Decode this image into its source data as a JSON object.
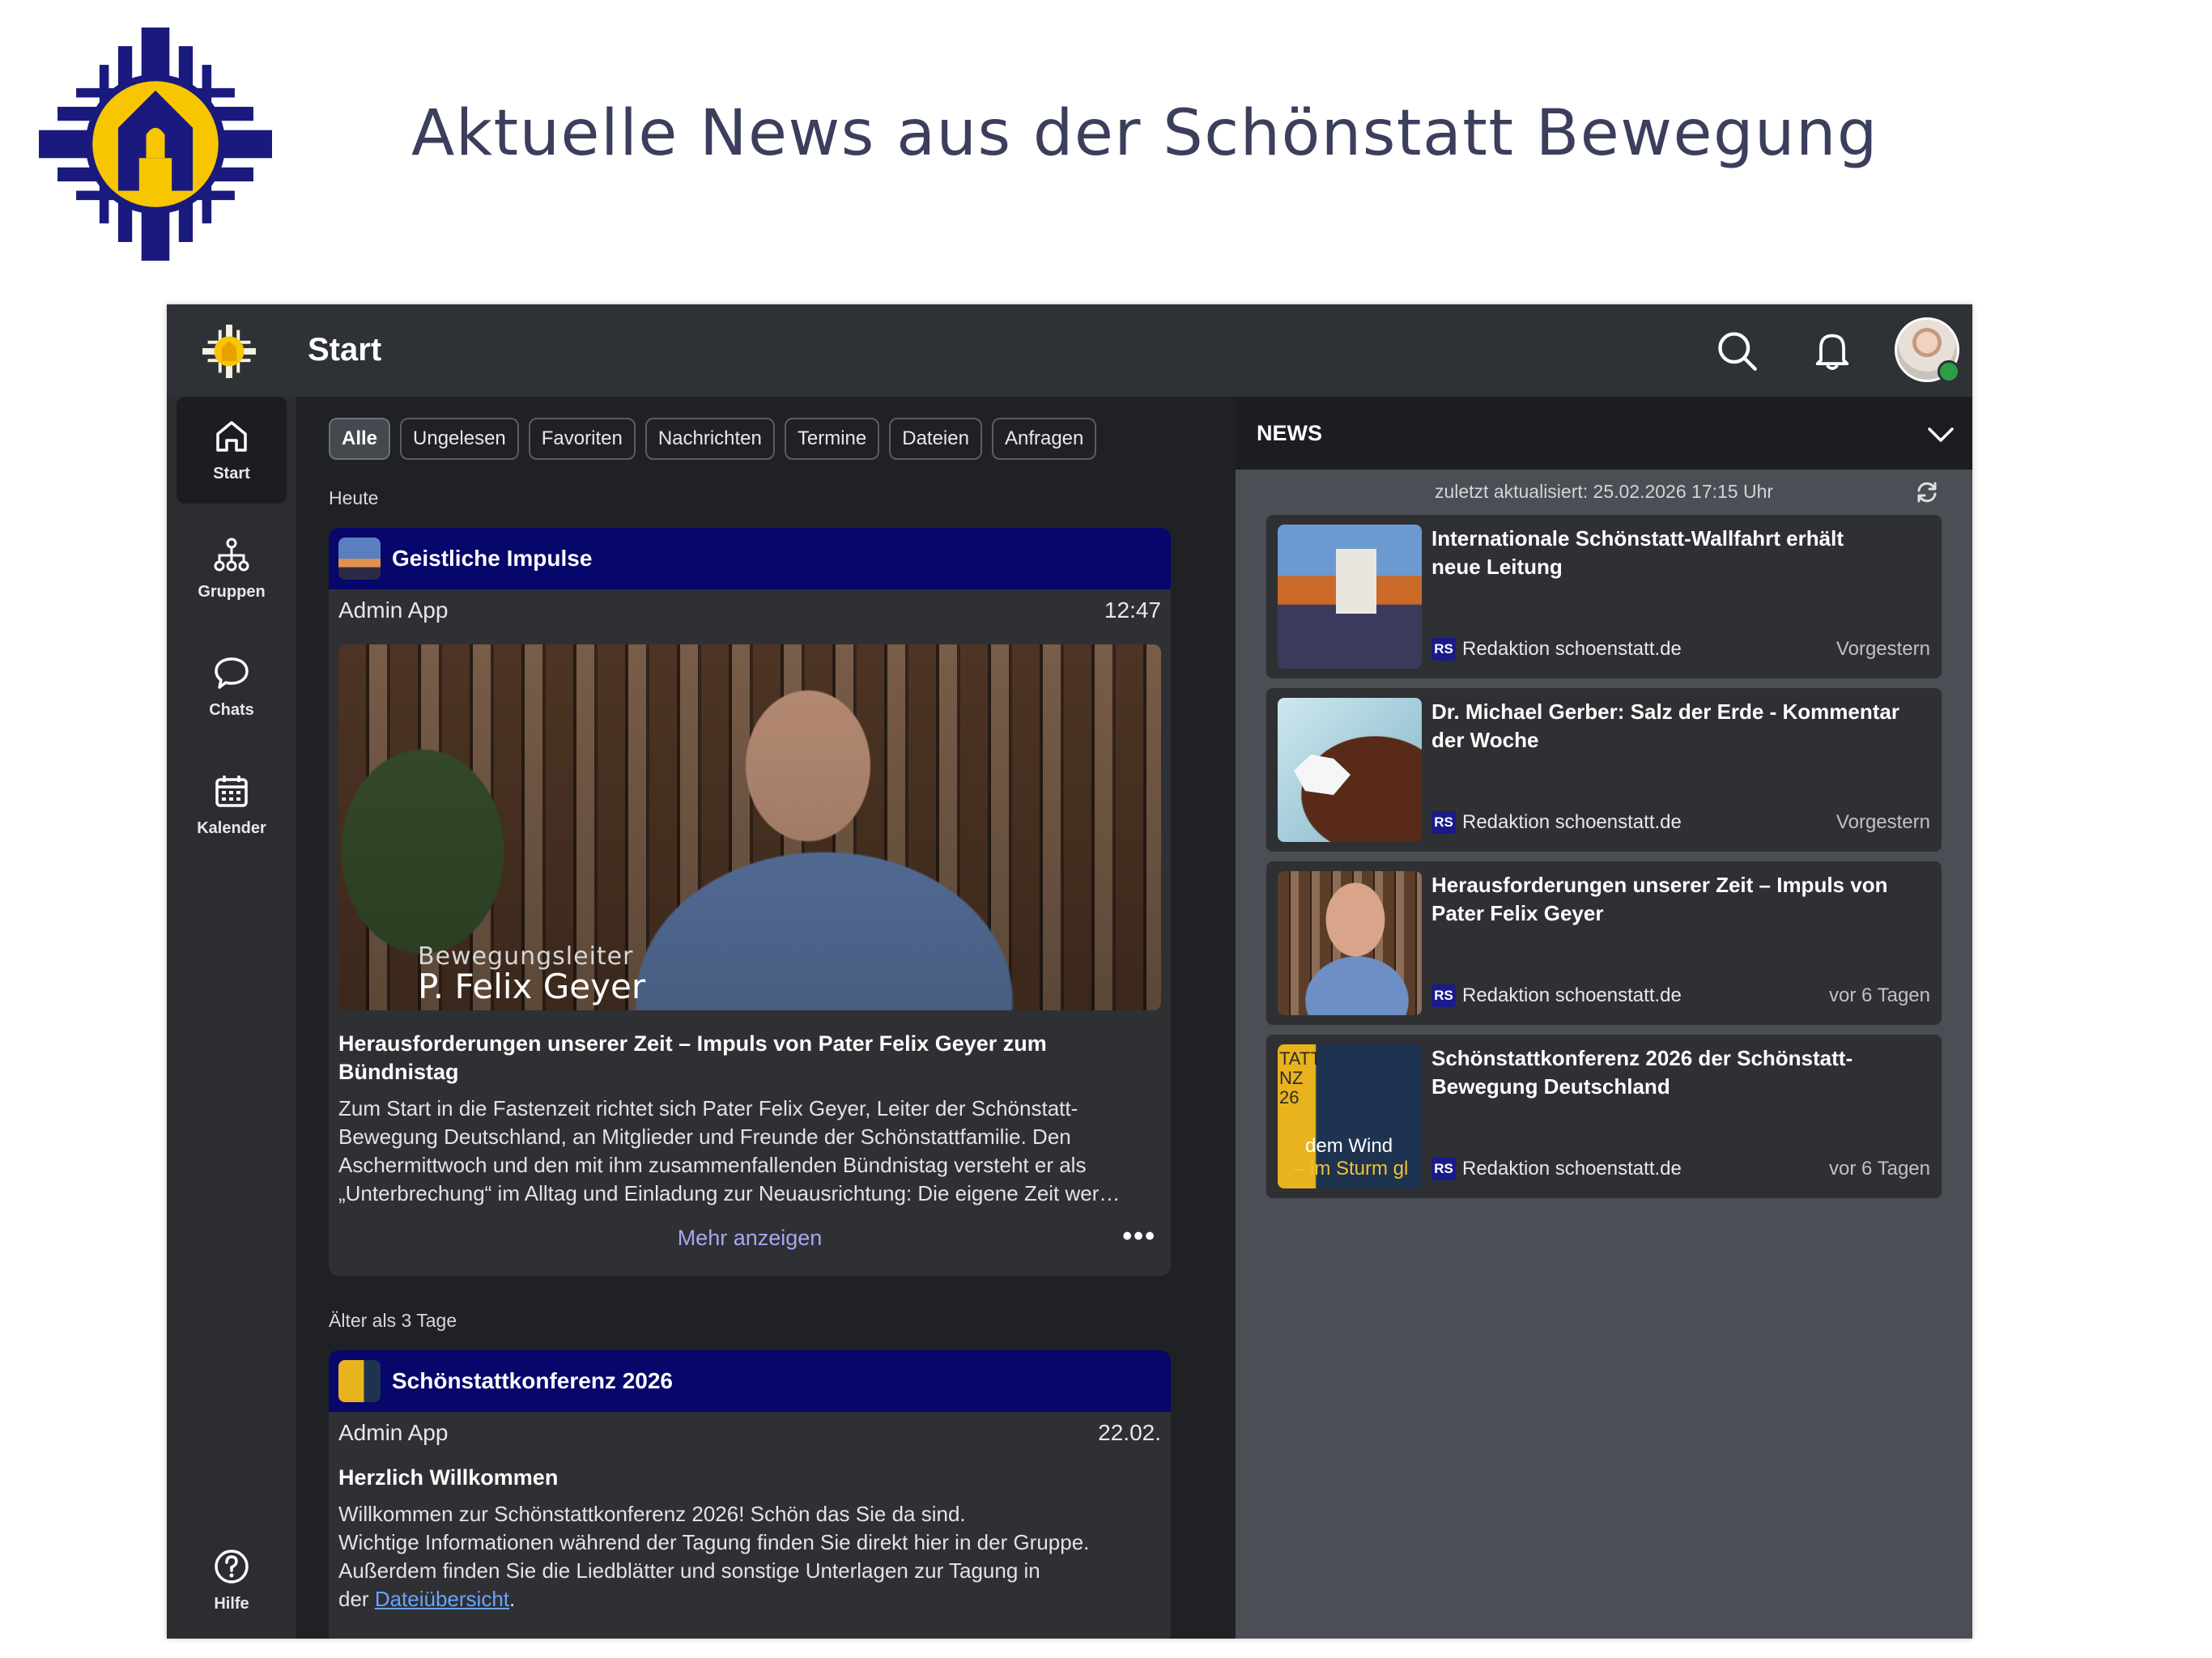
{
  "slide": {
    "title": "Aktuelle News aus der Schönstatt Bewegung"
  },
  "topbar": {
    "title": "Start",
    "search_icon": "search-icon",
    "bell_icon": "bell-icon"
  },
  "nav": {
    "items": [
      {
        "label": "Start",
        "icon": "home-icon",
        "active": true
      },
      {
        "label": "Gruppen",
        "icon": "groups-icon"
      },
      {
        "label": "Chats",
        "icon": "chat-icon"
      },
      {
        "label": "Kalender",
        "icon": "calendar-icon"
      }
    ],
    "help": {
      "label": "Hilfe",
      "icon": "help-icon"
    }
  },
  "filters": [
    "Alle",
    "Ungelesen",
    "Favoriten",
    "Nachrichten",
    "Termine",
    "Dateien",
    "Anfragen"
  ],
  "sections": {
    "today": "Heute",
    "older": "Älter als 3 Tage"
  },
  "posts": [
    {
      "group": "Geistliche Impulse",
      "author": "Admin App",
      "time": "12:47",
      "video_caption_small": "Bewegungsleiter",
      "video_caption_large": "P. Felix Geyer",
      "title_lines": [
        "Herausforderungen unserer Zeit – Impuls von Pater Felix Geyer zum",
        "Bündnistag"
      ],
      "body_lines": [
        "Zum Start in die Fastenzeit richtet sich Pater Felix Geyer, Leiter der Schönstatt-",
        "Bewegung Deutschland, an Mitglieder und Freunde der Schönstattfamilie. Den",
        "Aschermittwoch und den mit ihm zusammenfallenden Bündnistag versteht er als",
        "„Unterbrechung“ im Alltag und Einladung zur Neuausrichtung: Die eigene Zeit wer…"
      ],
      "more": "Mehr anzeigen",
      "menu": "•••"
    },
    {
      "group": "Schönstattkonferenz 2026",
      "author": "Admin App",
      "time": "22.02.",
      "title": "Herzlich Willkommen",
      "body_lines": [
        "Willkommen zur Schönstattkonferenz 2026! Schön das Sie da sind.",
        "Wichtige Informationen während der Tagung finden Sie direkt hier in der Gruppe.",
        "Außerdem finden Sie die Liedblätter und sonstige Unterlagen zur Tagung in"
      ],
      "last_prefix": "der",
      "link": "Dateiübersicht",
      "last_suffix": "."
    }
  ],
  "news": {
    "title": "NEWS",
    "updated": "zuletzt aktualisiert: 25.02.2026 17:15 Uhr",
    "items": [
      {
        "title_lines": [
          "Internationale Schönstatt-Wallfahrt erhält",
          "neue Leitung"
        ],
        "badge": "RS",
        "source": "Redaktion schoenstatt.de",
        "age": "Vorgestern"
      },
      {
        "title_lines": [
          "Dr. Michael Gerber: Salz der Erde - Kommentar",
          "der Woche"
        ],
        "badge": "RS",
        "source": "Redaktion schoenstatt.de",
        "age": "Vorgestern"
      },
      {
        "title_lines": [
          "Herausforderungen unserer Zeit – Impuls von",
          "Pater Felix Geyer"
        ],
        "badge": "RS",
        "source": "Redaktion schoenstatt.de",
        "age": "vor 6 Tagen"
      },
      {
        "title_lines": [
          "Schönstattkonferenz 2026 der Schönstatt-",
          "Bewegung Deutschland"
        ],
        "badge": "RS",
        "source": "Redaktion schoenstatt.de",
        "age": "vor 6 Tagen",
        "thumb_text": [
          "TATT",
          "NZ",
          "26"
        ],
        "thumb_line1": "dem Wind",
        "thumb_line2": "– im Sturm gl"
      }
    ]
  },
  "colors": {
    "accent": "#07066b",
    "brand_blue": "#1a1a7e",
    "brand_yellow": "#f7c600",
    "link": "#6aa3ff",
    "more": "#a9a6f2"
  }
}
